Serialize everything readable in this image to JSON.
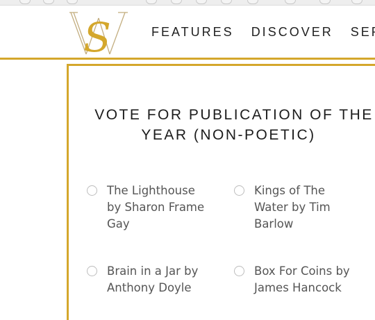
{
  "header": {
    "logo_text": "SW",
    "nav": [
      "FEATURES",
      "DISCOVER",
      "SER"
    ]
  },
  "poll": {
    "title_line1": "VOTE FOR PUBLICATION OF THE",
    "title_line2": "YEAR (NON-POETIC)",
    "options": [
      {
        "line1": "The Lighthouse",
        "line2": "by Sharon Frame",
        "line3": "Gay"
      },
      {
        "line1": "Kings of The",
        "line2": "Water by Tim",
        "line3": "Barlow"
      },
      {
        "line1": "Brain in a Jar by",
        "line2": "Anthony Doyle"
      },
      {
        "line1": "Box For Coins by",
        "line2": "James Hancock"
      }
    ]
  },
  "colors": {
    "accent": "#d4a72c",
    "text": "#1c1c1c",
    "option_text": "#555555"
  }
}
